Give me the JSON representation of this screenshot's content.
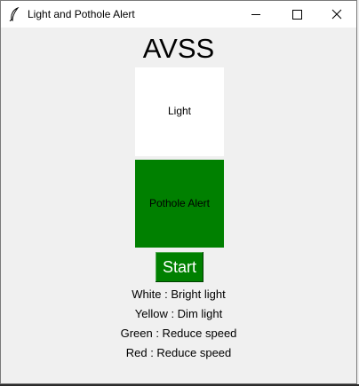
{
  "window": {
    "title": "Light and Pothole Alert",
    "controls": [
      "minimize-icon",
      "maximize-icon",
      "close-icon"
    ]
  },
  "app": {
    "heading": "AVSS",
    "light_label": "Light",
    "pothole_label": "Pothole Alert",
    "start_label": "Start",
    "colors": {
      "light_box": "#ffffff",
      "pothole_box": "#008000",
      "start_button": "#008000"
    }
  },
  "legend": [
    "White : Bright light",
    "Yellow : Dim light",
    "Green : Reduce speed",
    "Red : Reduce speed"
  ]
}
